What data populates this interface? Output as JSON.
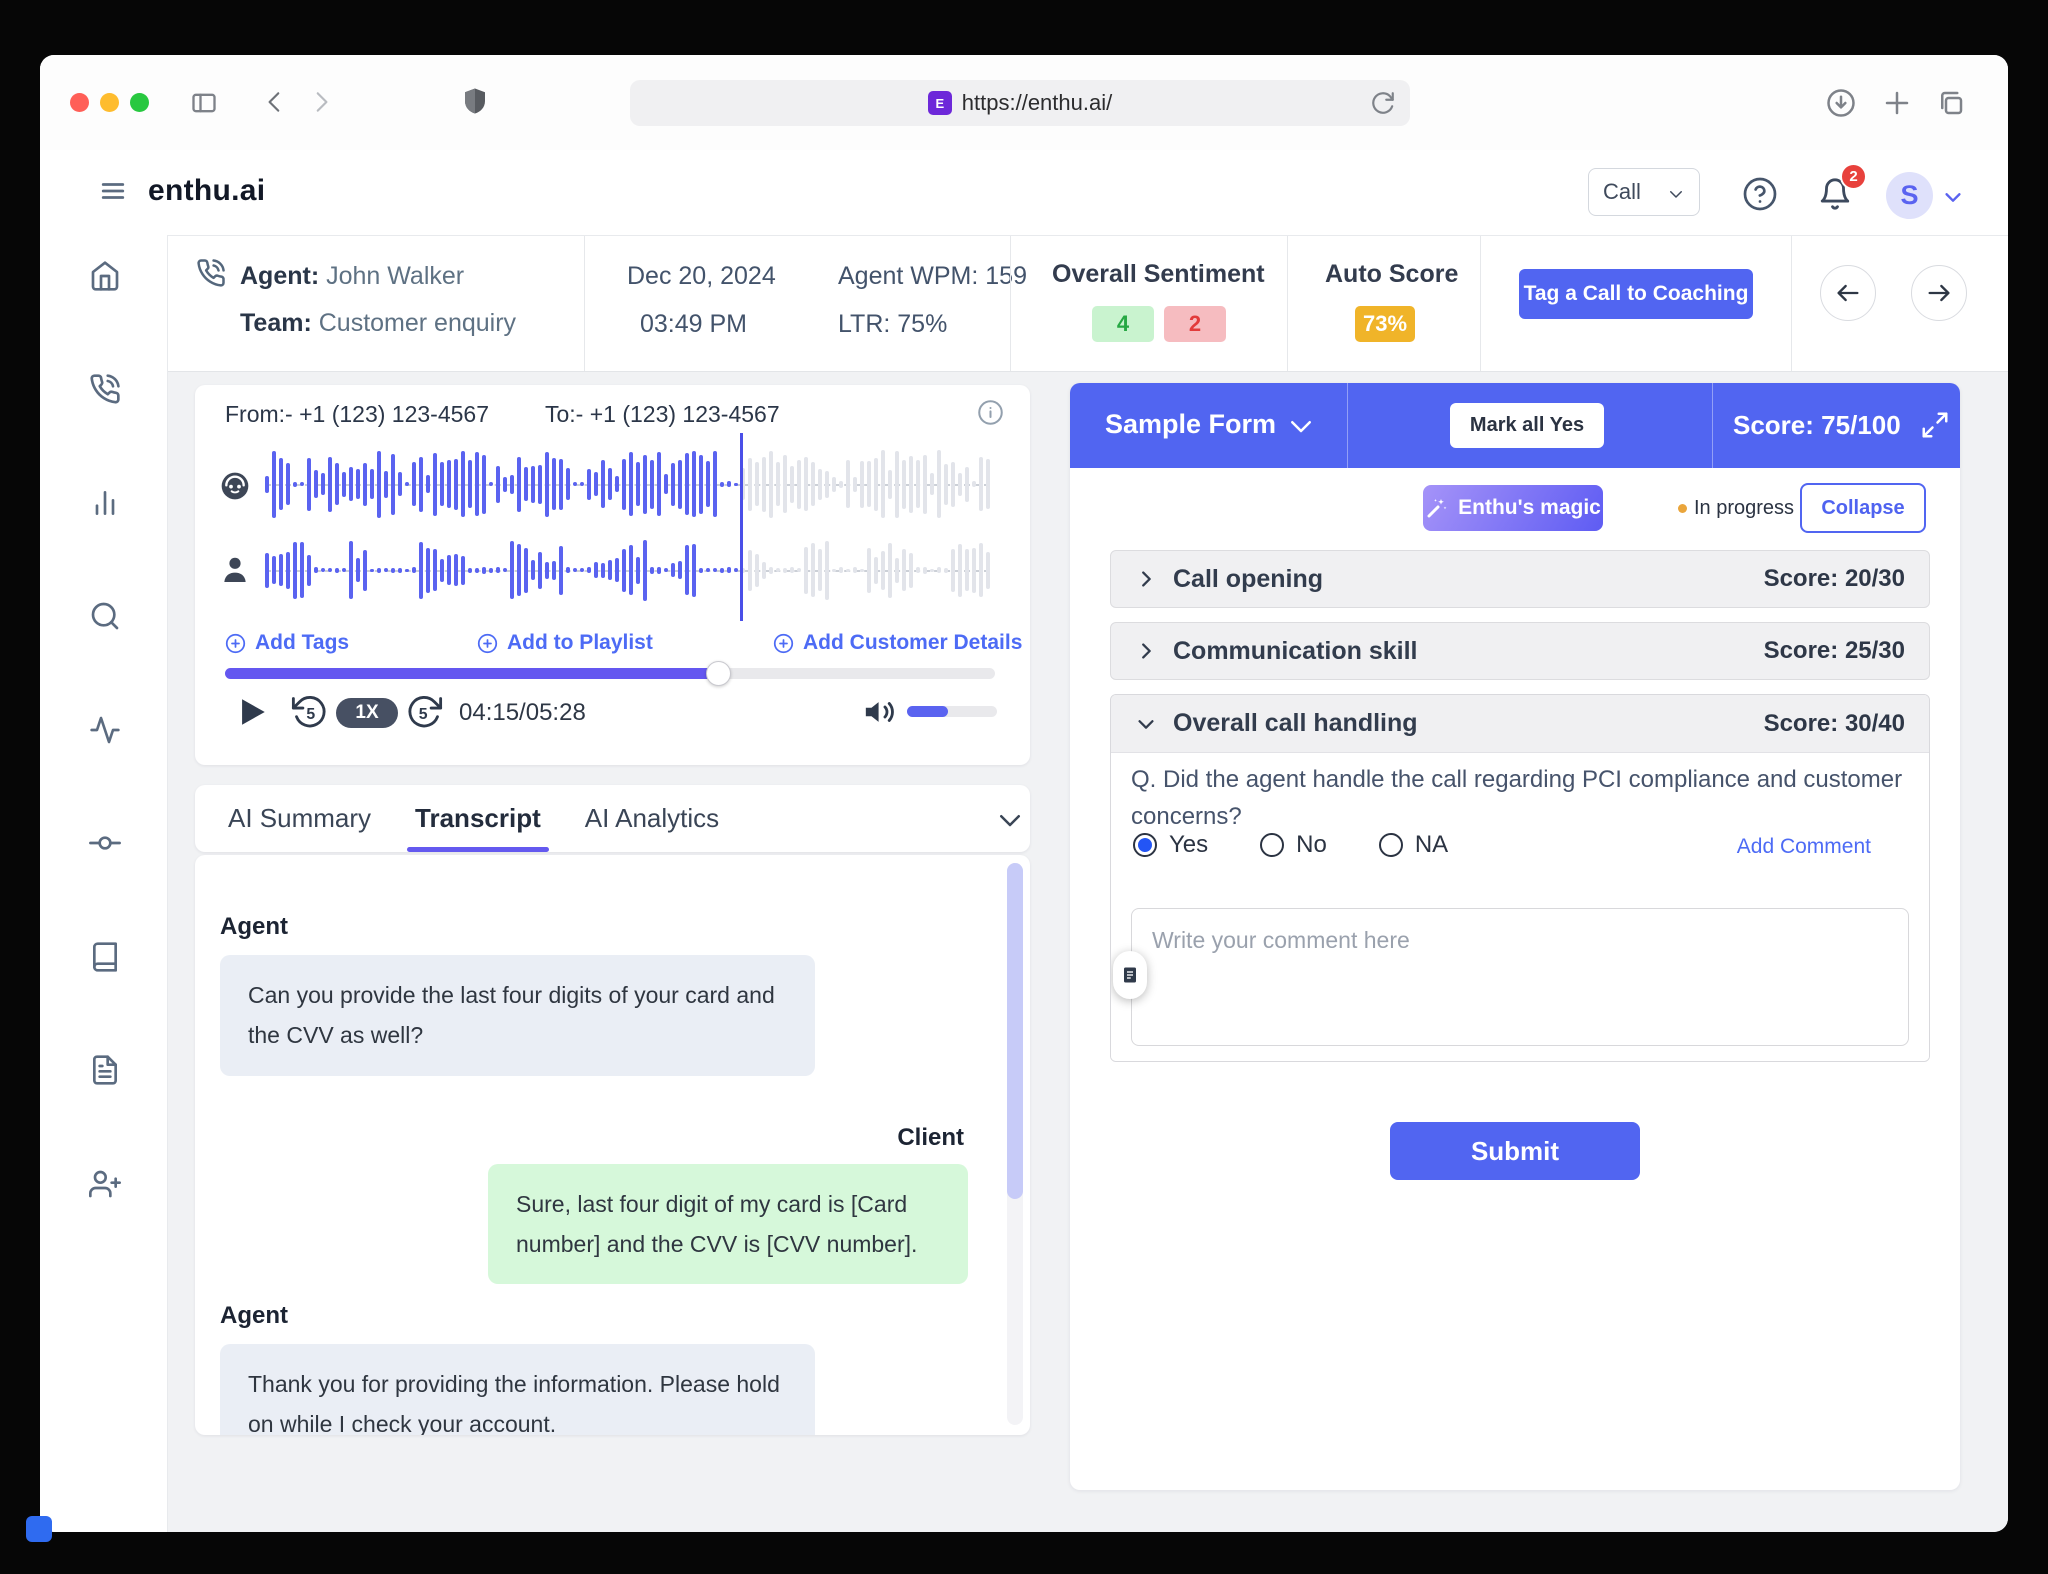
{
  "browser": {
    "url": "https://enthu.ai/",
    "favicon_letter": "E"
  },
  "header": {
    "logo": "enthu.ai",
    "call_selector": "Call",
    "notification_count": "2",
    "avatar_initial": "S"
  },
  "info_bar": {
    "agent_label": "Agent:",
    "agent_name": "John Walker",
    "team_label": "Team:",
    "team_name": "Customer enquiry",
    "date": "Dec 20, 2024",
    "time": "03:49 PM",
    "agent_wpm": "Agent WPM: 159",
    "ltr": "LTR: 75%",
    "sentiment_label": "Overall Sentiment",
    "sentiment_positive": "4",
    "sentiment_negative": "2",
    "auto_score_label": "Auto Score",
    "auto_score_value": "73%",
    "tag_coaching_button": "Tag a Call to Coaching"
  },
  "sidebar": {
    "icons": [
      "home",
      "calls",
      "analytics",
      "search",
      "activity",
      "integrations",
      "library",
      "reports",
      "add-user"
    ]
  },
  "player": {
    "from": "From:- +1 (123) 123-4567",
    "to": "To:- +1 (123) 123-4567",
    "add_tags": "Add Tags",
    "add_to_playlist": "Add to Playlist",
    "add_customer_details": "Add Customer Details",
    "speed": "1X",
    "time": "04:15/05:28",
    "progress_percent": 64,
    "playhead_percent": 65.5,
    "volume_percent": 45
  },
  "tabs": {
    "items": [
      {
        "label": "AI Summary",
        "active": false
      },
      {
        "label": "Transcript",
        "active": true
      },
      {
        "label": "AI Analytics",
        "active": false
      }
    ]
  },
  "transcript": {
    "messages": [
      {
        "speaker": "Agent",
        "text": "Can you provide the last four digits of your card and the CVV as well?"
      },
      {
        "speaker": "Client",
        "text": "Sure, last four digit of my card is [Card number] and the CVV is [CVV number]."
      },
      {
        "speaker": "Agent",
        "text": "Thank you for providing the information. Please hold on while I check your account."
      }
    ]
  },
  "form_panel": {
    "form_name": "Sample Form",
    "mark_all_button": "Mark all Yes",
    "score": "Score: 75/100",
    "magic_button": "Enthu's magic",
    "status": "In progress",
    "collapse_button": "Collapse",
    "sections": [
      {
        "label": "Call opening",
        "score": "Score: 20/30",
        "expanded": false
      },
      {
        "label": "Communication skill",
        "score": "Score: 25/30",
        "expanded": false
      },
      {
        "label": "Overall call handling",
        "score": "Score: 30/40",
        "expanded": true
      }
    ],
    "question": "Q. Did the agent handle the call regarding PCI compliance and customer concerns?",
    "options": [
      {
        "label": "Yes",
        "selected": true
      },
      {
        "label": "No",
        "selected": false
      },
      {
        "label": "NA",
        "selected": false
      }
    ],
    "add_comment_link": "Add Comment",
    "comment_placeholder": "Write your comment here",
    "submit_button": "Submit"
  },
  "colors": {
    "accent_blue": "#5165f1",
    "waveform_blue": "#5a63f0",
    "sentiment_green_bg": "#c9f3cf",
    "sentiment_green_text": "#27a844",
    "sentiment_red_bg": "#f6bcc0",
    "sentiment_red_text": "#e23b3b",
    "auto_score_bg": "#f0b429"
  }
}
